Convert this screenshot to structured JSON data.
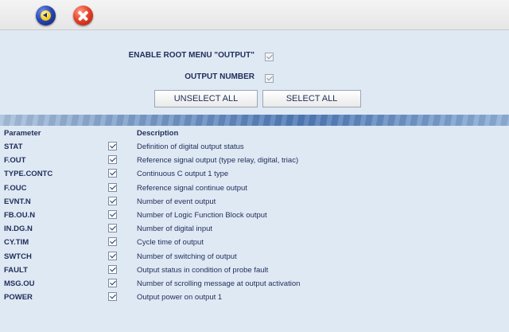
{
  "toolbar": {
    "back_icon": "back-arrow-icon",
    "close_icon": "close-icon"
  },
  "options": [
    {
      "label": "ENABLE ROOT MENU \"OUTPUT\"",
      "checked": true
    },
    {
      "label": "OUTPUT NUMBER",
      "checked": true
    }
  ],
  "buttons": {
    "unselect_all": "UNSELECT ALL",
    "select_all": "SELECT ALL"
  },
  "table": {
    "headers": {
      "parameter": "Parameter",
      "description": "Description"
    },
    "rows": [
      {
        "parameter": "STAT",
        "checked": true,
        "description": "Definition of digital output status"
      },
      {
        "parameter": "F.OUT",
        "checked": true,
        "description": "Reference signal output (type relay, digital, triac)"
      },
      {
        "parameter": "TYPE.CONTC",
        "checked": true,
        "description": "Continuous C output 1 type"
      },
      {
        "parameter": "F.OUC",
        "checked": true,
        "description": "Reference signal continue output"
      },
      {
        "parameter": "EVNT.N",
        "checked": true,
        "description": "Number of event output"
      },
      {
        "parameter": "FB.OU.N",
        "checked": true,
        "description": "Number of Logic Function Block output"
      },
      {
        "parameter": "IN.DG.N",
        "checked": true,
        "description": "Number of digital input"
      },
      {
        "parameter": "CY.TIM",
        "checked": true,
        "description": "Cycle time of output"
      },
      {
        "parameter": "SWTCH",
        "checked": true,
        "description": "Number of switching of output"
      },
      {
        "parameter": "FAULT",
        "checked": true,
        "description": "Output status in condition of probe fault"
      },
      {
        "parameter": "MSG.OU",
        "checked": true,
        "description": "Number of scrolling message at output activation"
      },
      {
        "parameter": "POWER",
        "checked": true,
        "description": "Output power on output 1"
      }
    ]
  }
}
